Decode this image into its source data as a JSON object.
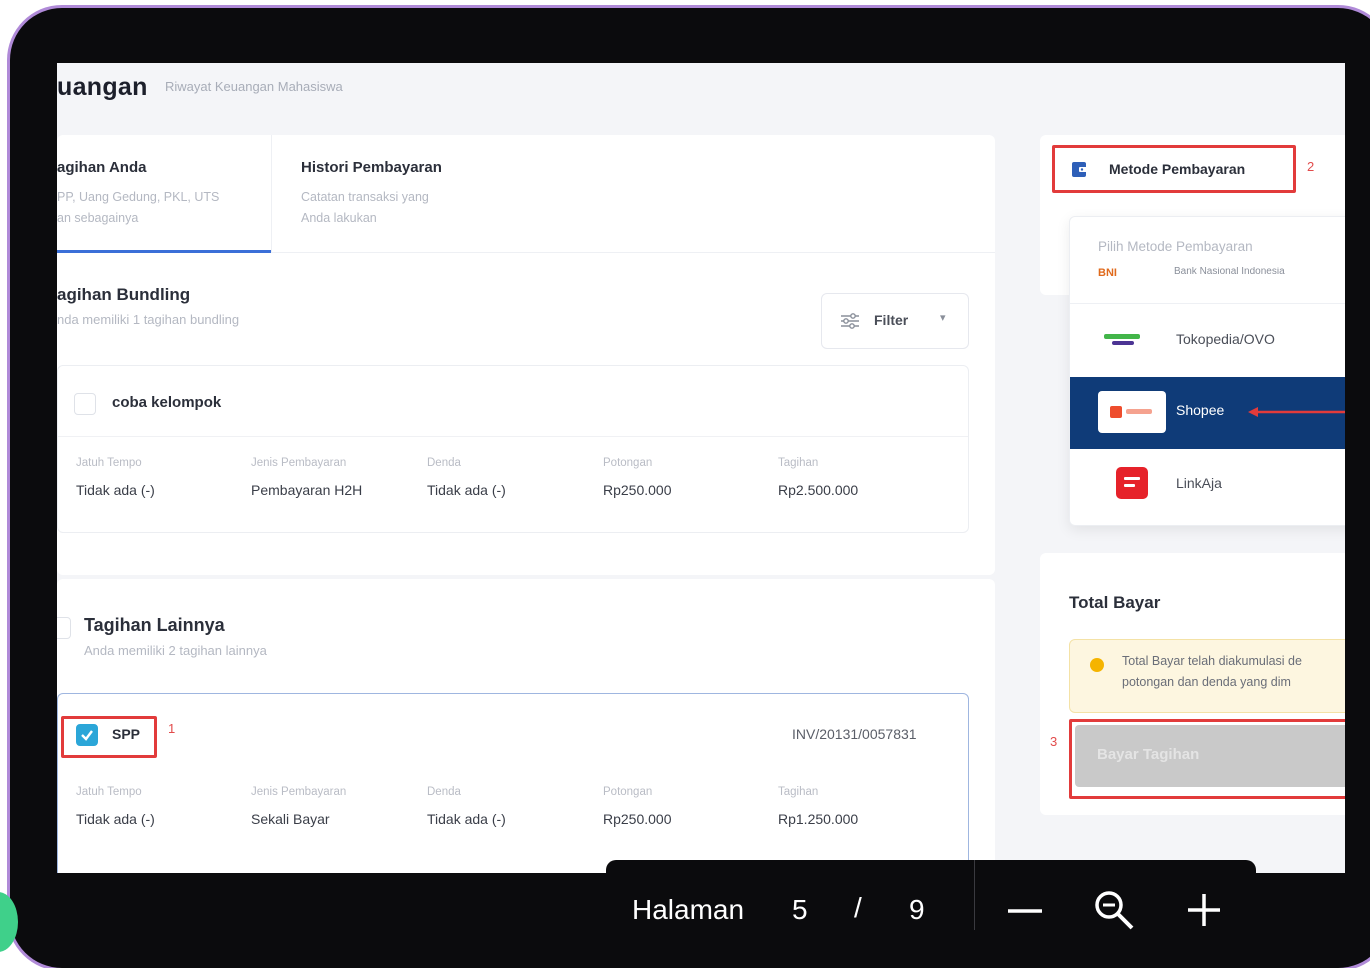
{
  "header": {
    "title": "uangan",
    "subtitle": "Riwayat Keuangan Mahasiswa"
  },
  "tabs": [
    {
      "title": "agihan Anda",
      "desc_line1": "PP, Uang Gedung, PKL, UTS",
      "desc_line2": "an sebagainya"
    },
    {
      "title": "Histori Pembayaran",
      "desc_line1": "Catatan transaksi yang",
      "desc_line2": "Anda lakukan"
    }
  ],
  "bundling": {
    "title": "agihan Bundling",
    "desc": "nda memiliki 1 tagihan bundling",
    "filter_label": "Filter",
    "item": {
      "name": "coba kelompok",
      "fields": [
        {
          "label": "Jatuh Tempo",
          "value": "Tidak ada (-)"
        },
        {
          "label": "Jenis Pembayaran",
          "value": "Pembayaran H2H"
        },
        {
          "label": "Denda",
          "value": "Tidak ada (-)"
        },
        {
          "label": "Potongan",
          "value": "Rp250.000"
        },
        {
          "label": "Tagihan",
          "value": "Rp2.500.000"
        }
      ]
    }
  },
  "lainnya": {
    "title": "Tagihan Lainnya",
    "desc": "Anda memiliki 2 tagihan lainnya",
    "item": {
      "name": "SPP",
      "invoice": "INV/20131/0057831",
      "fields": [
        {
          "label": "Jatuh Tempo",
          "value": "Tidak ada (-)"
        },
        {
          "label": "Jenis Pembayaran",
          "value": "Sekali Bayar"
        },
        {
          "label": "Denda",
          "value": "Tidak ada (-)"
        },
        {
          "label": "Potongan",
          "value": "Rp250.000"
        },
        {
          "label": "Tagihan",
          "value": "Rp1.250.000"
        }
      ]
    }
  },
  "payment": {
    "method_button": "Metode Pembayaran",
    "choose_label": "Pilih Metode Pembayaran",
    "bni_text": "Bank Nasional Indonesia",
    "items": [
      {
        "label": "Tokopedia/OVO",
        "icon": "tokopedia-ovo-logo"
      },
      {
        "label": "Shopee",
        "icon": "shopee-logo",
        "selected": true
      },
      {
        "label": "LinkAja",
        "icon": "linkaja-logo"
      }
    ],
    "total_title": "Total Bayar",
    "note_line1": "Total Bayar telah diakumulasi de",
    "note_line2": "potongan dan denda yang dim",
    "pay_button": "Bayar Tagihan"
  },
  "annotations": {
    "one": "1",
    "two": "2",
    "three": "3"
  },
  "viewer": {
    "page_label": "Halaman",
    "current_page": "5",
    "separator": "/",
    "total_pages": "9"
  },
  "colors": {
    "accent": "#3b6fd8",
    "selected_method_bg": "#0f3b78",
    "checkbox_on": "#2ba6d8",
    "annotation_red": "#e23b3b",
    "note_bg": "#fdf6e0",
    "pay_button_bg": "#c9c9c9"
  }
}
